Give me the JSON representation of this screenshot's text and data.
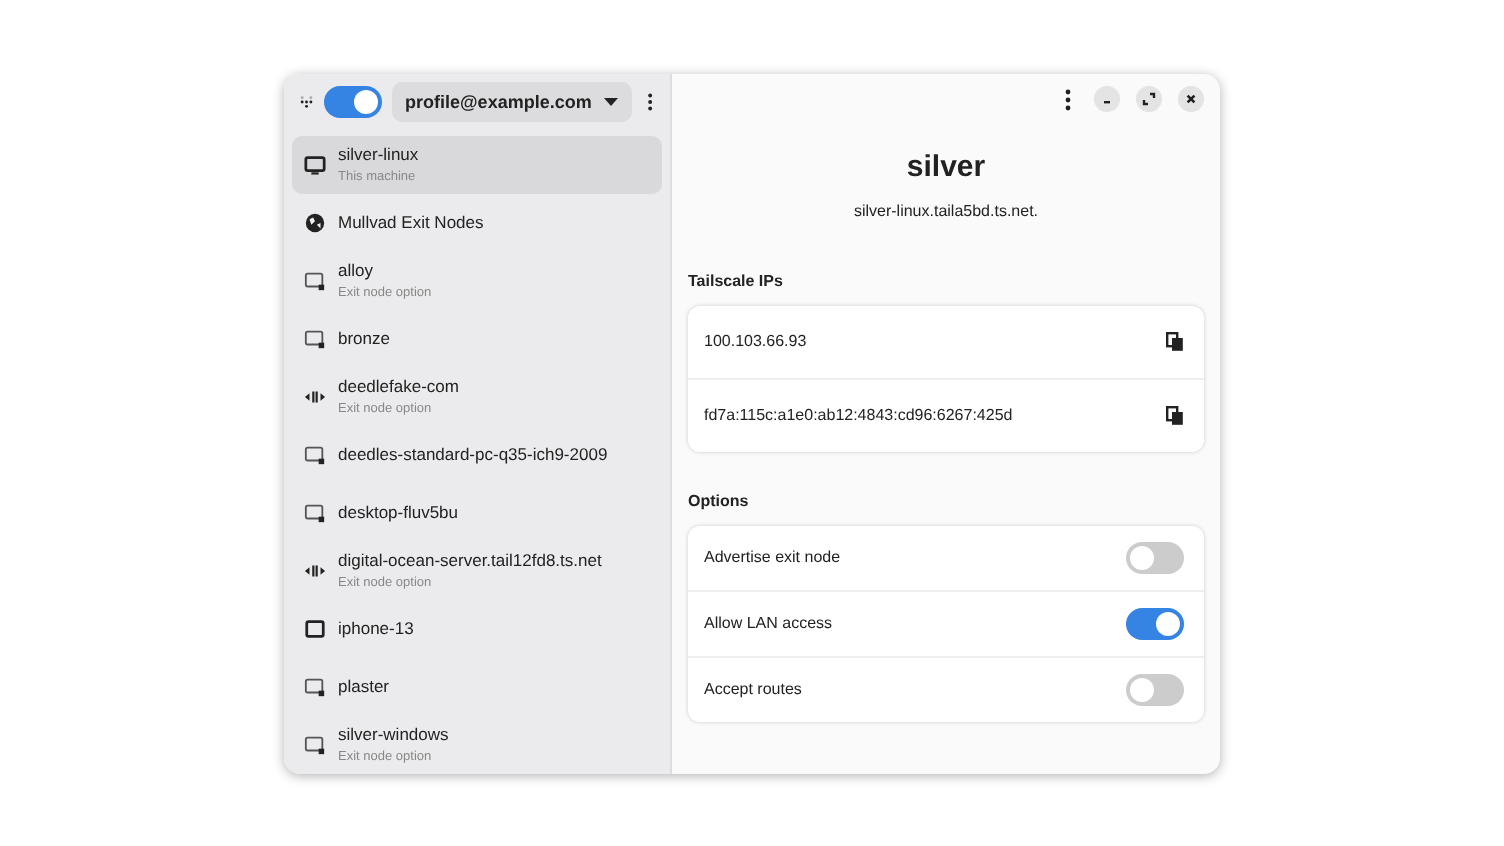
{
  "header": {
    "vpn_on": true,
    "profile": "profile@example.com"
  },
  "peers": [
    {
      "name": "silver-linux",
      "subtitle": "This machine",
      "kind": "desktop",
      "selected": true
    },
    {
      "name": "Mullvad Exit Nodes",
      "kind": "globe",
      "selected": false
    },
    {
      "name": "alloy",
      "subtitle": "Exit node option",
      "kind": "peer",
      "selected": false
    },
    {
      "name": "bronze",
      "kind": "peer",
      "selected": false
    },
    {
      "name": "deedlefake-com",
      "subtitle": "Exit node option",
      "kind": "server",
      "selected": false
    },
    {
      "name": "deedles-standard-pc-q35-ich9-2009",
      "kind": "peer",
      "selected": false
    },
    {
      "name": "desktop-fluv5bu",
      "kind": "peer",
      "selected": false
    },
    {
      "name": "digital-ocean-server.tail12fd8.ts.net",
      "subtitle": "Exit node option",
      "kind": "server",
      "selected": false
    },
    {
      "name": "iphone-13",
      "kind": "phone",
      "selected": false
    },
    {
      "name": "plaster",
      "kind": "peer",
      "selected": false
    },
    {
      "name": "silver-windows",
      "subtitle": "Exit node option",
      "kind": "peer",
      "selected": false
    }
  ],
  "detail": {
    "title": "silver",
    "hostname": "silver-linux.taila5bd.ts.net.",
    "ips_heading": "Tailscale IPs",
    "ips": [
      "100.103.66.93",
      "fd7a:115c:a1e0:ab12:4843:cd96:6267:425d"
    ],
    "options_heading": "Options",
    "options": [
      {
        "label": "Advertise exit node",
        "on": false
      },
      {
        "label": "Allow LAN access",
        "on": true
      },
      {
        "label": "Accept routes",
        "on": false
      }
    ]
  }
}
